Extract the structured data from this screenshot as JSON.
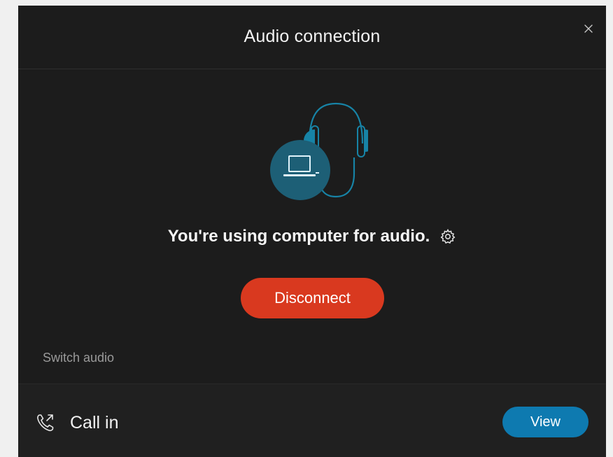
{
  "dialog": {
    "title": "Audio connection",
    "close_icon": "close-icon"
  },
  "main": {
    "illustration_icon": "computer-audio-headset-icon",
    "status_text": "You're using computer for audio.",
    "settings_icon": "gear-icon",
    "disconnect_label": "Disconnect",
    "switch_audio_label": "Switch audio"
  },
  "footer": {
    "callin_icon": "phone-callin-icon",
    "callin_label": "Call in",
    "view_label": "View"
  },
  "colors": {
    "dialog_background": "#1c1c1c",
    "accent_teal": "#1783a6",
    "disconnect_red": "#d9391f",
    "view_blue": "#0e7ab0"
  }
}
